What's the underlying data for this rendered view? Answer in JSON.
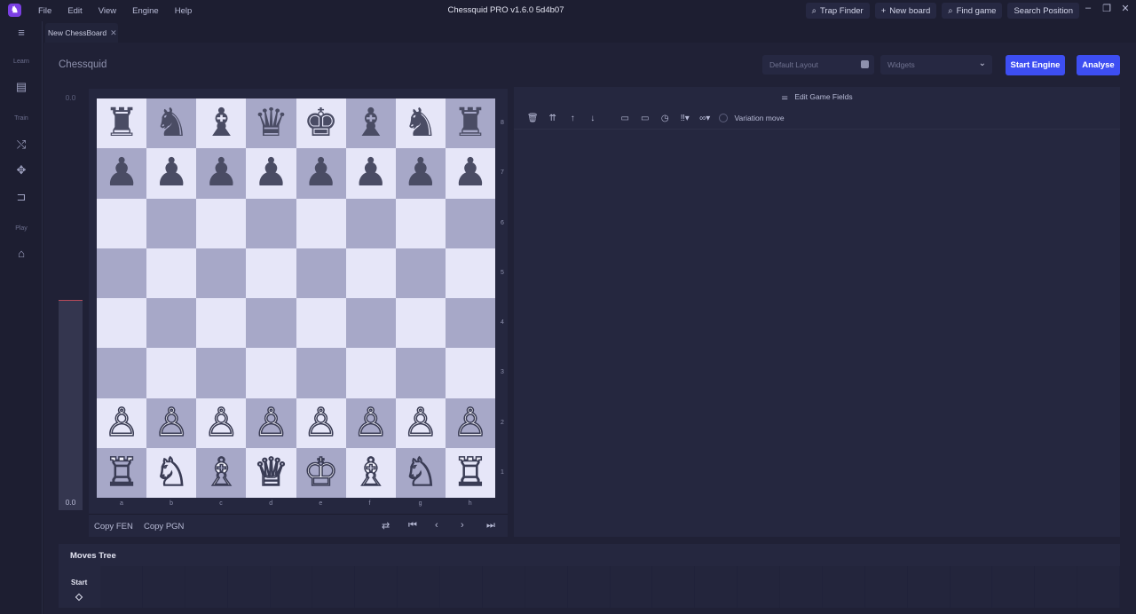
{
  "titlebar": {
    "menu": [
      "File",
      "Edit",
      "View",
      "Engine",
      "Help"
    ],
    "app_title": "Chessquid PRO v1.6.0 5d4b07",
    "actions": [
      {
        "label": "Trap Finder",
        "icon": "search-icon"
      },
      {
        "label": "New board",
        "icon": "plus-icon"
      },
      {
        "label": "Find game",
        "icon": "search-icon"
      },
      {
        "label": "Search Position",
        "icon": ""
      }
    ]
  },
  "tabs": [
    {
      "label": "New ChessBoard"
    }
  ],
  "sidebar": {
    "sections": [
      "Learn",
      "Train",
      "Play"
    ]
  },
  "page": {
    "title": "Chessquid",
    "layout_placeholder": "Default Layout",
    "widgets_placeholder": "Widgets",
    "start_engine": "Start Engine",
    "analyse": "Analyse"
  },
  "eval": {
    "top": "0.0",
    "bottom": "0.0",
    "fill": 0.5
  },
  "board": {
    "ranks": [
      "8",
      "7",
      "6",
      "5",
      "4",
      "3",
      "2",
      "1"
    ],
    "files": [
      "a",
      "b",
      "c",
      "d",
      "e",
      "f",
      "g",
      "h"
    ],
    "position": [
      [
        "♜",
        "♞",
        "♝",
        "♛",
        "♚",
        "♝",
        "♞",
        "♜"
      ],
      [
        "♟",
        "♟",
        "♟",
        "♟",
        "♟",
        "♟",
        "♟",
        "♟"
      ],
      [
        "",
        "",
        "",
        "",
        "",
        "",
        "",
        ""
      ],
      [
        "",
        "",
        "",
        "",
        "",
        "",
        "",
        ""
      ],
      [
        "",
        "",
        "",
        "",
        "",
        "",
        "",
        ""
      ],
      [
        "",
        "",
        "",
        "",
        "",
        "",
        "",
        ""
      ],
      [
        "♙",
        "♙",
        "♙",
        "♙",
        "♙",
        "♙",
        "♙",
        "♙"
      ],
      [
        "♖",
        "♘",
        "♗",
        "♕",
        "♔",
        "♗",
        "♘",
        "♖"
      ]
    ],
    "light_color": "#e6e6f8",
    "dark_color": "#a7a8c8"
  },
  "board_footer": {
    "copy_fen": "Copy FEN",
    "copy_pgn": "Copy PGN"
  },
  "right_panel": {
    "edit_fields": "Edit Game Fields",
    "variation_move": "Variation move"
  },
  "moves_tree": {
    "title": "Moves Tree",
    "start": "Start"
  },
  "colors": {
    "accent": "#3d4ef2",
    "logo": "#7b3fe4"
  }
}
